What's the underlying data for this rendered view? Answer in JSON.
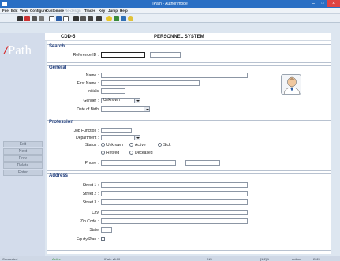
{
  "window": {
    "title": "IPath - Author mode",
    "minimize": "–",
    "maximize": "□",
    "close": "×"
  },
  "menu": [
    "File",
    "Edit",
    "View",
    "Configure",
    "Customise",
    "Re-design",
    "Traces",
    "Key",
    "Jump",
    "Help"
  ],
  "toolbar_icons": [
    "print-icon",
    "preview-icon",
    "find-icon",
    "copy-icon",
    "paste-icon",
    "form-icon",
    "insert-icon",
    "image-icon",
    "table-icon",
    "fx-icon",
    "pie-icon",
    "chart-icon",
    "bulb-icon",
    "key-icon",
    "user-icon",
    "clock-icon"
  ],
  "header": {
    "form_id": "CDD-5",
    "system_title": "PERSONNEL SYSTEM"
  },
  "logo": {
    "slash": "/",
    "text": "Path"
  },
  "nav_buttons": [
    "Exit",
    "Next",
    "Prev",
    "Delete",
    "Enter"
  ],
  "search": {
    "title": "Search",
    "reference_id_label": "Reference ID :",
    "reference_id_value": "",
    "reference_id_extra": ""
  },
  "general": {
    "title": "General",
    "name_label": "Name :",
    "name_value": "",
    "first_name_label": "First Name :",
    "first_name_value": "",
    "initials_label": "Initials",
    "initials_value": "",
    "gender_label": "Gender :",
    "gender_value": "Unknown",
    "dob_label": "Date of Birth",
    "dob_value": ""
  },
  "profession": {
    "title": "Profession",
    "job_function_label": "Job Function :",
    "job_function_value": "",
    "department_label": "Department :",
    "department_value": "",
    "status_label": "Status :",
    "status_options": [
      "Unknown",
      "Active",
      "Sick",
      "Retired",
      "Deceased"
    ],
    "status_selected": "Unknown",
    "phone_label": "Phone :",
    "phone_value": "",
    "phone_value_2": ""
  },
  "address": {
    "title": "Address",
    "street1_label": "Street 1 :",
    "street2_label": "Street 2 :",
    "street3_label": "Street 3 :",
    "city_label": "City",
    "zip_label": "Zip Code :",
    "state_label": "State",
    "equity_plan_label": "Equity Plan :"
  },
  "status_bar": {
    "connection": "Connected",
    "state": "Active",
    "mode": "IPath v6.00",
    "db": "INS",
    "coords": "[1,2] 1",
    "user": "author",
    "year": "2020"
  },
  "colors": {
    "titlebar": "#2a6fc4",
    "section_title": "#1c3a7a",
    "logo_slash": "#d81e1e",
    "close_button": "#e04343"
  }
}
